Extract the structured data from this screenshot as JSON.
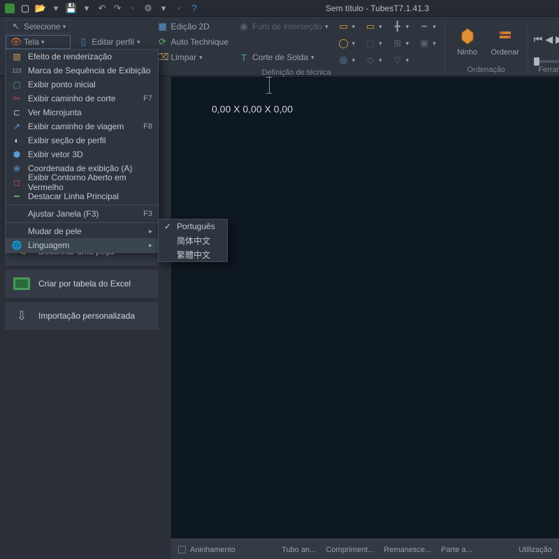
{
  "title": "Sem título - TubesT7.1.41.3",
  "qat": [
    "app",
    "new",
    "open",
    "save",
    "undo",
    "redo",
    "settings",
    "help"
  ],
  "ribbon": {
    "selecione": "Selecione",
    "tela": "Tela",
    "editar_perfil": "Editar perfil",
    "edicao_2d": "Edição 2D",
    "auto_technique": "Auto Technique",
    "limpar": "Limpar",
    "furo": "Furo de interseção",
    "corte_solda": "Corte de Solda",
    "definicao": "Definição de técnica",
    "ninho": "Ninho",
    "ordenar": "Ordenar",
    "ordenacao": "Ordenação",
    "ferramenta": "Ferramenta"
  },
  "menu_items": [
    {
      "icon": "render",
      "label": "Efeito de renderização",
      "shortcut": "",
      "arrow": false,
      "color": "#d0a060"
    },
    {
      "icon": "123",
      "label": "Marca de Sequência de Exibição",
      "shortcut": "",
      "arrow": false,
      "color": "#9aa3ad"
    },
    {
      "icon": "box",
      "label": "Exibir ponto inicial",
      "shortcut": "",
      "arrow": false,
      "color": "#4aa080"
    },
    {
      "icon": "cut",
      "label": "Exibir caminho de corte",
      "shortcut": "F7",
      "arrow": false,
      "color": "#b05050"
    },
    {
      "icon": "micro",
      "label": "Ver Microjunta",
      "shortcut": "",
      "arrow": false,
      "color": "#b0b6bf"
    },
    {
      "icon": "travel",
      "label": "Exibir caminho de viagem",
      "shortcut": "F8",
      "arrow": false,
      "color": "#5a9bd5"
    },
    {
      "icon": "profile",
      "label": "Exibir seção de perfil",
      "shortcut": "",
      "arrow": false,
      "color": "#c9cfd7"
    },
    {
      "icon": "3d",
      "label": "Exibir vetor 3D",
      "shortcut": "",
      "arrow": false,
      "color": "#5a9bd5"
    },
    {
      "icon": "coord",
      "label": "Coordenada de exibição (A)",
      "shortcut": "",
      "arrow": false,
      "color": "#5a9bd5"
    },
    {
      "icon": "open",
      "label": "Exibir Contorno Aberto em Vermelho",
      "shortcut": "",
      "arrow": false,
      "color": "#d05050"
    },
    {
      "icon": "main",
      "label": "Destacar Linha Principal",
      "shortcut": "",
      "arrow": false,
      "color": "#60b060"
    },
    {
      "icon": "",
      "label": "Ajustar Janela (F3)",
      "shortcut": "F3",
      "arrow": false,
      "color": ""
    },
    {
      "icon": "",
      "label": "Mudar de pele",
      "shortcut": "",
      "arrow": true,
      "color": ""
    },
    {
      "icon": "globe",
      "label": "Linguagem",
      "shortcut": "",
      "arrow": true,
      "color": "#9aa3ad",
      "highlight": true
    }
  ],
  "submenu_items": [
    {
      "label": "Português",
      "checked": true
    },
    {
      "label": "简体中文",
      "checked": false
    },
    {
      "label": "繁體中文",
      "checked": false
    }
  ],
  "actions": [
    {
      "icon": "pencil",
      "label": "Desenhar uma peça",
      "color": "#e0c050"
    },
    {
      "icon": "excel",
      "label": "Criar por tabela do Excel",
      "color": "#4a9a5a"
    },
    {
      "icon": "import",
      "label": "Importação personalizada",
      "color": "#a0a6af"
    }
  ],
  "viewport_dims": "0,00 X 0,00 X 0,00",
  "statusbar": {
    "aninhamento": "Aninhamento",
    "tubo": "Tubo an...",
    "compriment": "Compriment...",
    "remanesce": "Remanesce...",
    "parte": "Parte a...",
    "utilizacao": "Utilização"
  }
}
